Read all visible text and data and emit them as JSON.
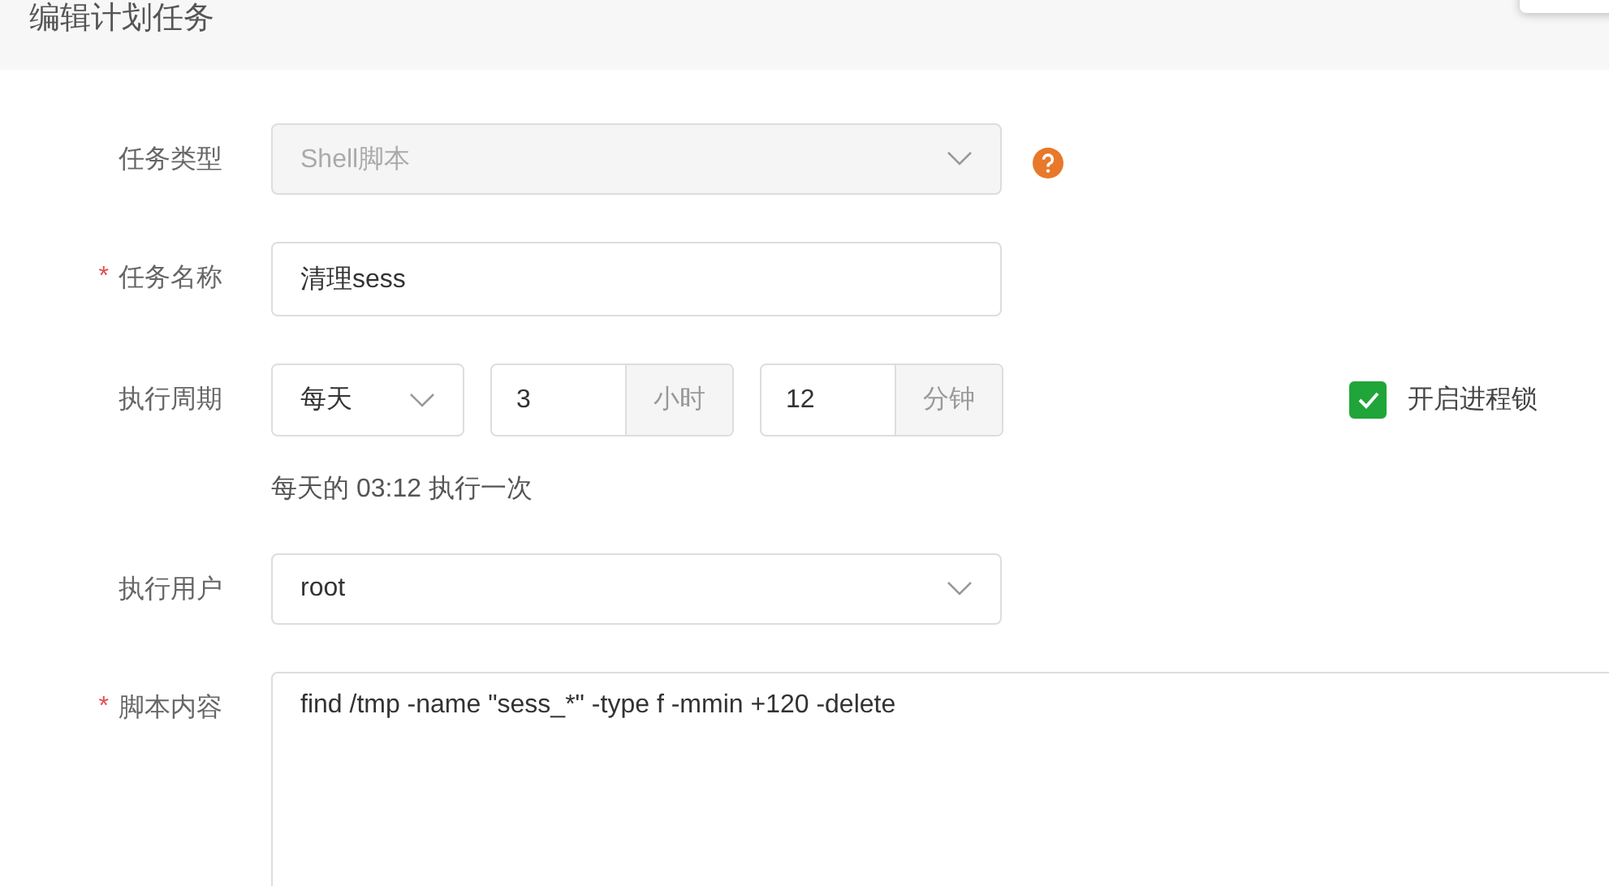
{
  "dialog": {
    "title": "编辑计划任务"
  },
  "fields": [
    {
      "kind": "select",
      "label": "任务类型",
      "value": "Shell脚本",
      "disabled": true,
      "help": true
    },
    {
      "kind": "input",
      "label": "任务名称",
      "required_mark": "*",
      "value": "清理sess"
    },
    {
      "kind": "period",
      "label": "执行周期",
      "period": "每天",
      "hour": "3",
      "hour_unit": "小时",
      "minute": "12",
      "minute_unit": "分钟",
      "lock": {
        "label": "开启进程锁",
        "checked": true
      },
      "hint": "每天的 03:12 执行一次"
    },
    {
      "kind": "select",
      "label": "执行用户",
      "value": "root"
    },
    {
      "kind": "textarea",
      "label": "脚本内容",
      "required_mark": "*",
      "value": "find /tmp -name \"sess_*\" -type f -mmin +120 -delete"
    }
  ]
}
